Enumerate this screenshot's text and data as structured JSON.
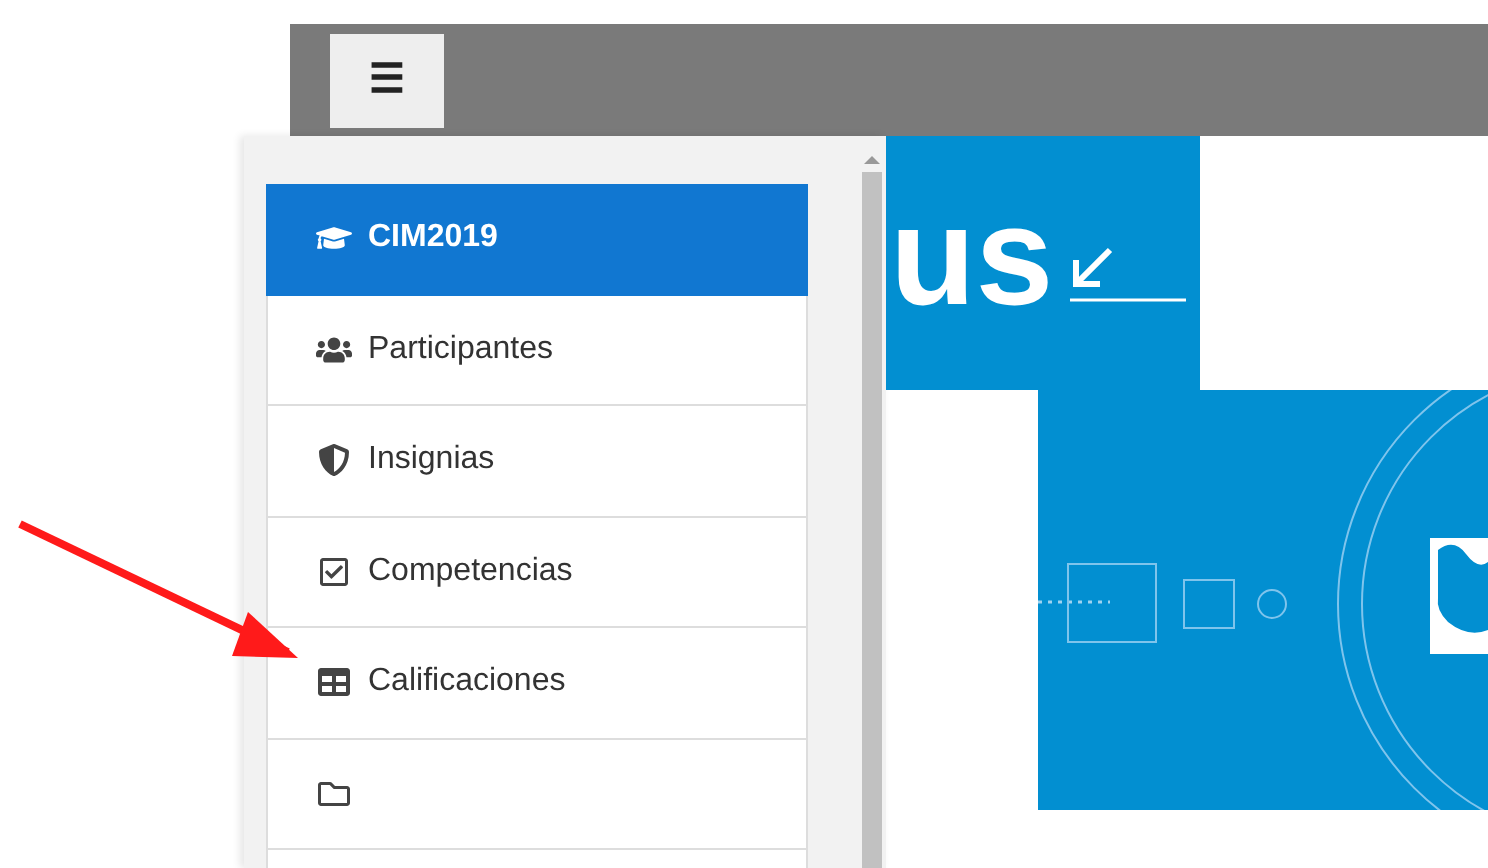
{
  "menu_button": {
    "label": "☰"
  },
  "course_menu": [
    {
      "kind": "course",
      "label": "CIM2019",
      "selected": true
    },
    {
      "kind": "participants",
      "label": "Participantes",
      "selected": false
    },
    {
      "kind": "badges",
      "label": "Insignias",
      "selected": false
    },
    {
      "kind": "competencies",
      "label": "Competencias",
      "selected": false
    },
    {
      "kind": "grades",
      "label": "Calificaciones",
      "selected": false
    },
    {
      "kind": "folder",
      "selected": false
    },
    {
      "kind": "blank",
      "selected": false
    }
  ],
  "banner": {
    "heading": "us"
  }
}
